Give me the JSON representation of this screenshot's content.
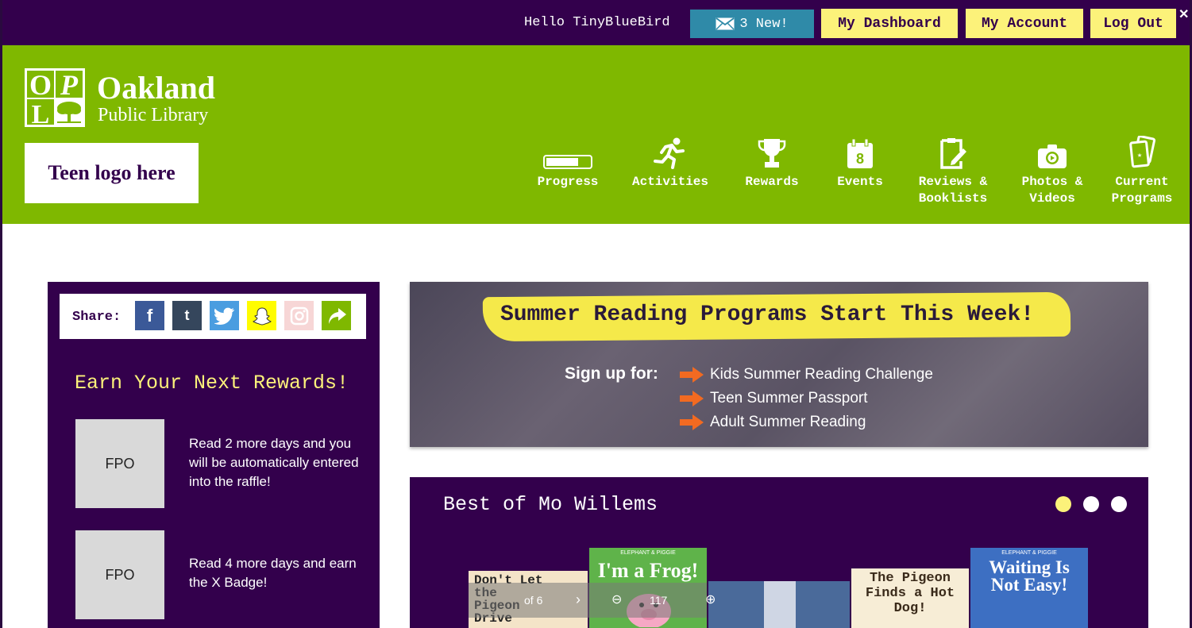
{
  "topbar": {
    "greeting": "Hello TinyBlueBird",
    "messages_label": "3 New!",
    "dashboard_label": "My Dashboard",
    "account_label": "My Account",
    "logout_label": "Log Out",
    "close_label": "✕"
  },
  "brand": {
    "logo_letters": [
      "O",
      "P",
      "L"
    ],
    "name_line1": "Oakland",
    "name_line2": "Public Library",
    "teen_logo": "Teen logo here"
  },
  "nav": [
    {
      "label_1": "Progress",
      "label_2": "",
      "icon": "progress-bar-icon"
    },
    {
      "label_1": "Activities",
      "label_2": "",
      "icon": "running-person-icon"
    },
    {
      "label_1": "Rewards",
      "label_2": "",
      "icon": "trophy-icon"
    },
    {
      "label_1": "Events",
      "label_2": "",
      "icon": "calendar-icon",
      "badge": "8"
    },
    {
      "label_1": "Reviews &",
      "label_2": "Booklists",
      "icon": "clipboard-edit-icon"
    },
    {
      "label_1": "Photos &",
      "label_2": "Videos",
      "icon": "camera-icon"
    },
    {
      "label_1": "Current",
      "label_2": "Programs",
      "icon": "cards-icon"
    }
  ],
  "share": {
    "label": "Share:",
    "buttons": [
      {
        "icon": "facebook-icon",
        "glyph": "f",
        "color": "#3b5998"
      },
      {
        "icon": "tumblr-icon",
        "glyph": "t",
        "color": "#35465c"
      },
      {
        "icon": "twitter-icon",
        "glyph": "",
        "color": "#4a9de0"
      },
      {
        "icon": "snapchat-icon",
        "glyph": "",
        "color": "#fffc00"
      },
      {
        "icon": "instagram-icon",
        "glyph": "",
        "color": "#f7d6d6"
      },
      {
        "icon": "share-arrow-icon",
        "glyph": "",
        "color": "#7fb800"
      }
    ]
  },
  "rewards": {
    "title": "Earn Your Next Rewards!",
    "items": [
      {
        "placeholder": "FPO",
        "text": "Read 2 more days and you will be automatically entered into the raffle!"
      },
      {
        "placeholder": "FPO",
        "text": "Read 4 more days and earn the X Badge!"
      }
    ]
  },
  "banner": {
    "title": "Summer Reading Programs Start This Week!",
    "signup_label": "Sign up for:",
    "programs": [
      "Kids Summer Reading Challenge",
      "Teen Summer Passport",
      "Adult Summer Reading"
    ]
  },
  "carousel": {
    "title": "Best of Mo Willems",
    "active_dot": 0,
    "dot_count": 3,
    "books": [
      {
        "title": "Don't Let the Pigeon Drive",
        "color": "#f4e4c8"
      },
      {
        "title": "I'm a Frog!",
        "series": "ELEPHANT & PIGGIE",
        "color": "#5fb34a"
      },
      {
        "title": "",
        "color": "#4a6a9a"
      },
      {
        "title": "The Pigeon Finds a Hot Dog!",
        "color": "#f7edd6"
      },
      {
        "title": "Waiting Is Not Easy!",
        "series": "ELEPHANT & PIGGIE",
        "color": "#3d6fc2"
      }
    ],
    "controls": {
      "page": "of 6",
      "zoom": "117"
    }
  },
  "colors": {
    "purple": "#33004c",
    "green": "#7fb800",
    "yellow": "#fcf27a",
    "teal": "#2f8aa8",
    "orange": "#f26a21"
  }
}
